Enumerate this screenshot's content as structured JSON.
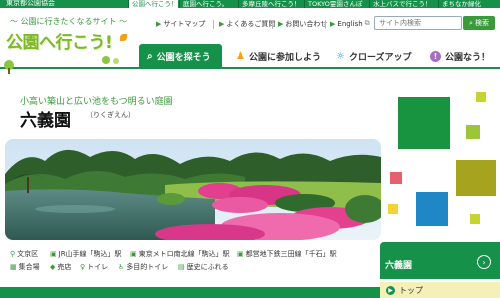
{
  "top_strip": {
    "org": "東京都公園協会",
    "tabs": [
      "公園へ行こう！",
      "庭園へ行こう。",
      "多摩丘陵へ行こう！",
      "TOKYO霊園さんぽ",
      "水上バスで行こう！",
      "まちなか緑化"
    ]
  },
  "header": {
    "tagline": "〜 公園に行きたくなるサイト 〜",
    "logo_text": "公園へ行こう!",
    "util_links": [
      "サイトマップ",
      "よくあるご質問",
      "お問い合わせ",
      "English"
    ],
    "search_placeholder": "サイト内検索",
    "search_button": "検索"
  },
  "nav": {
    "items": [
      "公園を探そう",
      "公園に参加しよう",
      "クローズアップ",
      "公園なう！"
    ]
  },
  "park": {
    "subtitle": "小高い築山と広い池をもつ明るい庭園",
    "name": "六義園",
    "reading": "（りくぎえん）"
  },
  "info_row1": [
    "文京区",
    "JR山手線「駒込」駅",
    "東京メトロ南北線「駒込」駅",
    "都営地下鉄三田線「千石」駅"
  ],
  "info_row2": [
    "集合場",
    "売店",
    "トイレ",
    "多目的トイレ",
    "歴史にふれる"
  ],
  "side": {
    "card_name": "六義園",
    "top_button": "トップ"
  },
  "colors": {
    "brand_green": "#16914a",
    "accent_green": "#3a9a3c",
    "logo_green": "#7bb82a"
  }
}
